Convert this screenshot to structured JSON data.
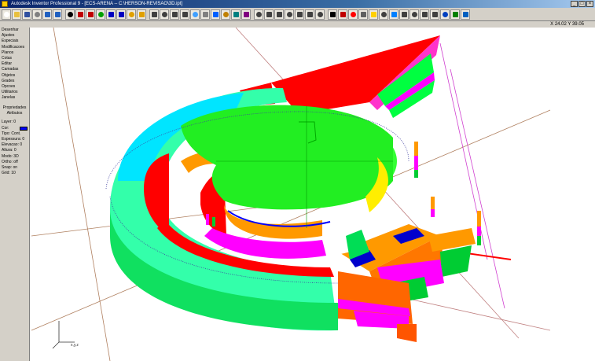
{
  "window": {
    "title": "Autodesk Inventor Professional 9 - [ECS-ARENA -- C:\\HERSON-REVISAO\\3D.ipt]",
    "controls": [
      "_",
      "□",
      "×"
    ]
  },
  "toolbar": {
    "buttons": [
      {
        "icon": "new-file-icon",
        "color": "#ffffff"
      },
      {
        "icon": "open-file-icon",
        "color": "#e8c040"
      },
      {
        "icon": "save-icon",
        "color": "#3050a0"
      },
      {
        "icon": "print-icon",
        "color": "#808080"
      },
      {
        "icon": "undo-icon",
        "color": "#2060c0"
      },
      {
        "icon": "redo-icon",
        "color": "#2060c0"
      },
      {
        "icon": "select-icon",
        "color": "#000000"
      },
      {
        "icon": "line-icon",
        "color": "#c00000"
      },
      {
        "icon": "arc-icon",
        "color": "#c00000"
      },
      {
        "icon": "circle-icon",
        "color": "#00a000"
      },
      {
        "icon": "rectangle-icon",
        "color": "#0000c0"
      },
      {
        "icon": "polygon-icon",
        "color": "#0000c0"
      },
      {
        "icon": "extrude-icon",
        "color": "#e0a000"
      },
      {
        "icon": "revolve-icon",
        "color": "#e0a000"
      },
      {
        "icon": "zoom-icon",
        "color": "#404040"
      },
      {
        "icon": "pan-icon",
        "color": "#404040"
      },
      {
        "icon": "rotate-icon",
        "color": "#404040"
      },
      {
        "icon": "fit-view-icon",
        "color": "#404040"
      },
      {
        "icon": "shade-icon",
        "color": "#40a0ff"
      },
      {
        "icon": "wireframe-icon",
        "color": "#808080"
      },
      {
        "icon": "sphere-icon",
        "color": "#0060ff"
      },
      {
        "icon": "cube-icon",
        "color": "#c08000"
      },
      {
        "icon": "cylinder-icon",
        "color": "#008080"
      },
      {
        "icon": "cone-icon",
        "color": "#800080"
      },
      {
        "icon": "mirror-icon",
        "color": "#404040"
      },
      {
        "icon": "array-icon",
        "color": "#404040"
      },
      {
        "icon": "fillet-icon",
        "color": "#404040"
      },
      {
        "icon": "chamfer-icon",
        "color": "#404040"
      },
      {
        "icon": "hole-icon",
        "color": "#404040"
      },
      {
        "icon": "measure-icon",
        "color": "#404040"
      },
      {
        "icon": "dimension-icon",
        "color": "#404040"
      },
      {
        "icon": "text-icon",
        "color": "#000000"
      },
      {
        "icon": "layer-icon",
        "color": "#c00000"
      },
      {
        "icon": "color-icon",
        "color": "#ff0000"
      },
      {
        "icon": "material-icon",
        "color": "#606060"
      },
      {
        "icon": "light-icon",
        "color": "#ffd000"
      },
      {
        "icon": "camera-icon",
        "color": "#404040"
      },
      {
        "icon": "render-icon",
        "color": "#0080ff"
      },
      {
        "icon": "export-icon",
        "color": "#404040"
      },
      {
        "icon": "import-icon",
        "color": "#404040"
      },
      {
        "icon": "properties-icon",
        "color": "#404040"
      },
      {
        "icon": "options-icon",
        "color": "#404040"
      },
      {
        "icon": "help-icon",
        "color": "#0040c0"
      },
      {
        "icon": "tree-icon",
        "color": "#008000"
      },
      {
        "icon": "globe-icon",
        "color": "#0060c0"
      }
    ]
  },
  "status": {
    "coordinates": "X 24.02  Y 39.05"
  },
  "left_panel": {
    "menu_items": [
      "Desenhar",
      "Ajustes",
      "Especiais",
      "Modificacoes",
      "Planos",
      "Cotas",
      "Editar",
      "Camadas",
      "Objetos",
      "Grades",
      "Opcoes",
      "Utilitarios",
      "Janelas"
    ],
    "section_labels": [
      "Propriedades",
      "Atributos"
    ],
    "properties": [
      {
        "label": "Layer: 0"
      },
      {
        "label": "Cor:"
      },
      {
        "label": "Tipo: Cont."
      },
      {
        "label": "Espessura: 0"
      },
      {
        "label": "Elevacao: 0"
      },
      {
        "label": "Altura: 0"
      },
      {
        "label": "Modo: 3D"
      },
      {
        "label": "Ortho: off"
      },
      {
        "label": "Snap: on"
      },
      {
        "label": "Grid: 10"
      }
    ],
    "swatch_color": "#0000ff"
  },
  "viewport": {
    "background": "#ffffff",
    "axis_label": "x,y,z"
  }
}
